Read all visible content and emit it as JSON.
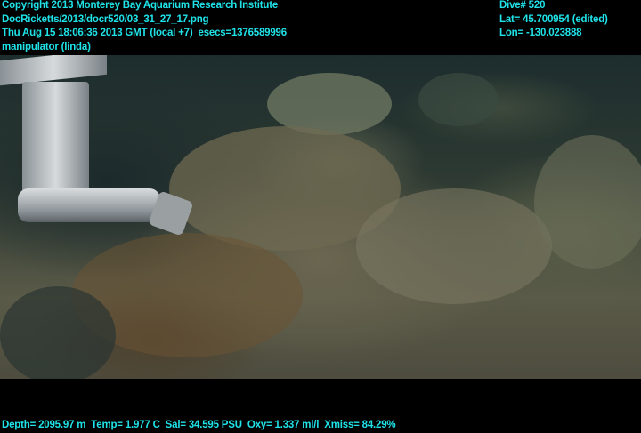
{
  "header_left": {
    "copyright": "Copyright 2013 Monterey Bay Aquarium Research Institute",
    "file_path": "DocRicketts/2013/docr520/03_31_27_17.png",
    "timestamp": "Thu Aug 15 18:06:36 2013 GMT (local +7)  esecs=1376589996",
    "camera_note": "manipulator (linda)"
  },
  "header_right": {
    "dive": "Dive# 520",
    "lat": "Lat= 45.700954 (edited)",
    "lon": "Lon= -130.023888"
  },
  "footer": {
    "sensors": "Depth= 2095.97 m  Temp= 1.977 C  Sal= 34.595 PSU  Oxy= 1.337 ml/l  Xmiss= 84.29%"
  },
  "colors": {
    "overlay_text": "#1fe3e8",
    "background": "#000000"
  }
}
